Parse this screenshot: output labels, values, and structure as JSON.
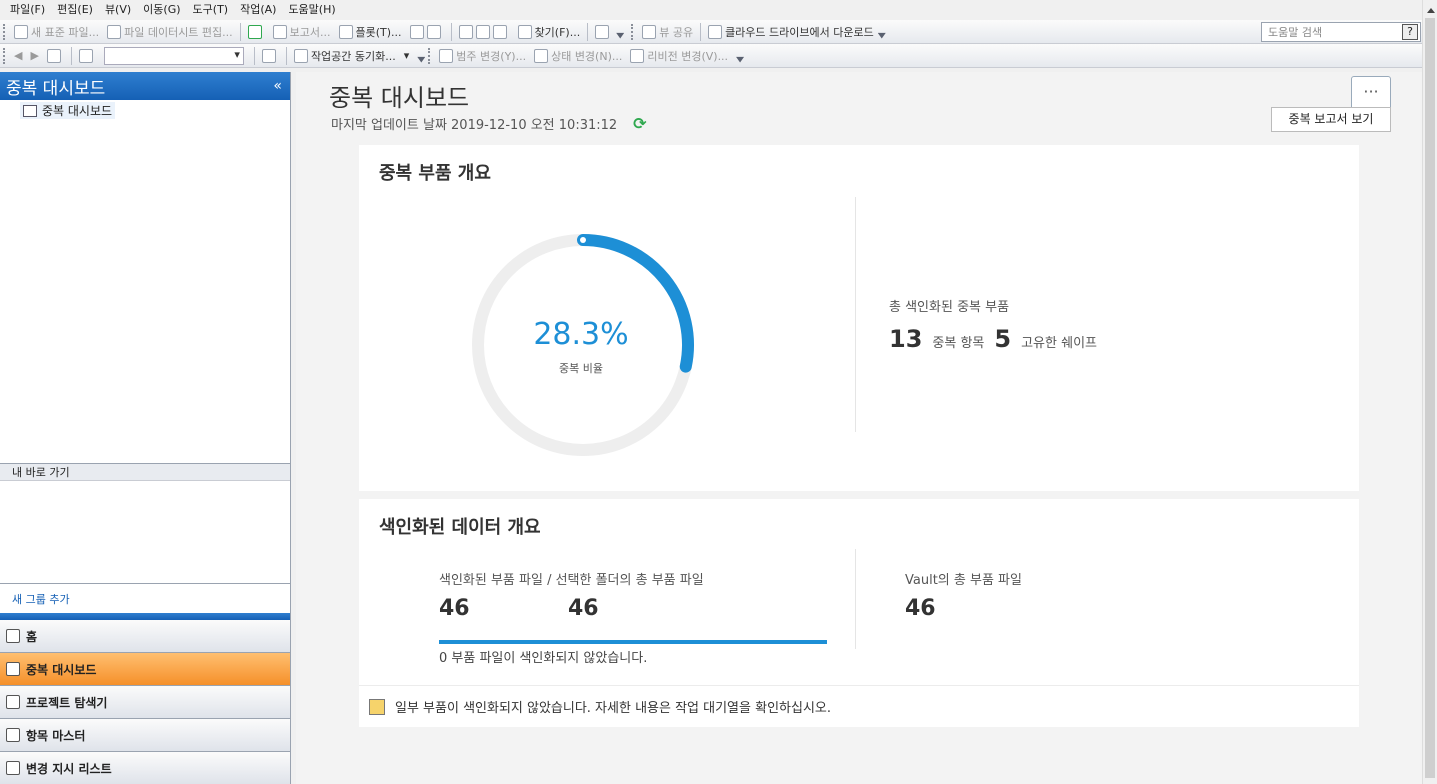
{
  "menu": [
    "파일(F)",
    "편집(E)",
    "뷰(V)",
    "이동(G)",
    "도구(T)",
    "작업(A)",
    "도움말(H)"
  ],
  "toolbar1": {
    "new_file": "새 표준 파일...",
    "datasheet": "파일 데이터시트 편집...",
    "report": "보고서...",
    "plot": "플롯(T)...",
    "find": "찾기(F)...",
    "share": "뷰 공유",
    "cloud": "클라우드 드라이브에서 다운로드",
    "help_placeholder": "도움말 검색",
    "help_q": "?"
  },
  "toolbar2": {
    "sync": "작업공간 동기화...",
    "category": "범주 변경(Y)...",
    "state": "상태 변경(N)...",
    "revision": "리비전 변경(V)..."
  },
  "left": {
    "header": "중복 대시보드",
    "collapse": "«",
    "tree_item": "중복 대시보드",
    "shortcuts": "내 바로 가기",
    "add_group": "새 그룹 추가",
    "nav": [
      "홈",
      "중복 대시보드",
      "프로젝트 탐색기",
      "항목 마스터",
      "변경 지시 리스트"
    ]
  },
  "main": {
    "title": "중복 대시보드",
    "updated": "마지막 업데이트 날짜 2019-12-10 오전 10:31:12",
    "more": "···",
    "tooltip": "중복 보고서 보기"
  },
  "card1": {
    "title": "중복 부품 개요",
    "percent_text": "28.3%",
    "percent_value": 28.3,
    "percent_label": "중복 비율",
    "total_label": "총 색인화된 중복 부품",
    "dup_items": "13",
    "dup_items_label": "중복 항목",
    "unique_shapes": "5",
    "unique_shapes_label": "고유한 쉐이프"
  },
  "card2": {
    "title": "색인화된 데이터 개요",
    "indexed_label": "색인화된 부품 파일 / 선택한 폴더의 총 부품 파일",
    "indexed": "46",
    "total_selected": "46",
    "vault_label": "Vault의 총 부품 파일",
    "vault_total": "46",
    "progress_value": 1.0,
    "not_indexed": "0  부품 파일이 색인화되지 않았습니다.",
    "warning": "일부 부품이 색인화되지 않았습니다. 자세한 내용은 작업 대기열을 확인하십시오."
  },
  "colors": {
    "accent": "#1d8fd6",
    "nav_active": "#f5902a",
    "refresh": "#2fa84f"
  }
}
